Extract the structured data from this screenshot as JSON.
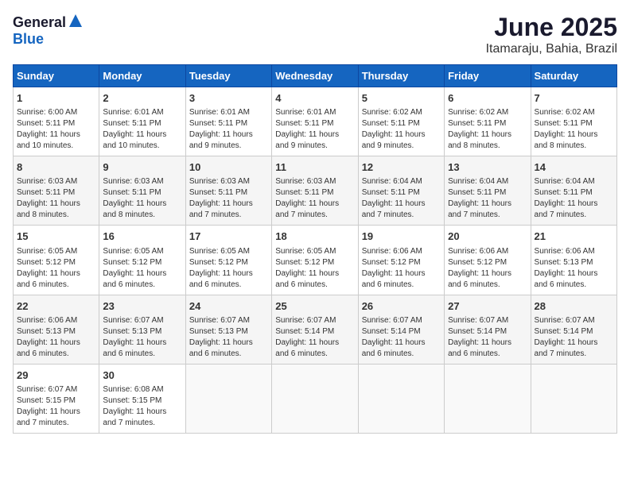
{
  "header": {
    "logo_general": "General",
    "logo_blue": "Blue",
    "month": "June 2025",
    "location": "Itamaraju, Bahia, Brazil"
  },
  "days_of_week": [
    "Sunday",
    "Monday",
    "Tuesday",
    "Wednesday",
    "Thursday",
    "Friday",
    "Saturday"
  ],
  "weeks": [
    [
      {
        "day": "1",
        "info": "Sunrise: 6:00 AM\nSunset: 5:11 PM\nDaylight: 11 hours\nand 10 minutes."
      },
      {
        "day": "2",
        "info": "Sunrise: 6:01 AM\nSunset: 5:11 PM\nDaylight: 11 hours\nand 10 minutes."
      },
      {
        "day": "3",
        "info": "Sunrise: 6:01 AM\nSunset: 5:11 PM\nDaylight: 11 hours\nand 9 minutes."
      },
      {
        "day": "4",
        "info": "Sunrise: 6:01 AM\nSunset: 5:11 PM\nDaylight: 11 hours\nand 9 minutes."
      },
      {
        "day": "5",
        "info": "Sunrise: 6:02 AM\nSunset: 5:11 PM\nDaylight: 11 hours\nand 9 minutes."
      },
      {
        "day": "6",
        "info": "Sunrise: 6:02 AM\nSunset: 5:11 PM\nDaylight: 11 hours\nand 8 minutes."
      },
      {
        "day": "7",
        "info": "Sunrise: 6:02 AM\nSunset: 5:11 PM\nDaylight: 11 hours\nand 8 minutes."
      }
    ],
    [
      {
        "day": "8",
        "info": "Sunrise: 6:03 AM\nSunset: 5:11 PM\nDaylight: 11 hours\nand 8 minutes."
      },
      {
        "day": "9",
        "info": "Sunrise: 6:03 AM\nSunset: 5:11 PM\nDaylight: 11 hours\nand 8 minutes."
      },
      {
        "day": "10",
        "info": "Sunrise: 6:03 AM\nSunset: 5:11 PM\nDaylight: 11 hours\nand 7 minutes."
      },
      {
        "day": "11",
        "info": "Sunrise: 6:03 AM\nSunset: 5:11 PM\nDaylight: 11 hours\nand 7 minutes."
      },
      {
        "day": "12",
        "info": "Sunrise: 6:04 AM\nSunset: 5:11 PM\nDaylight: 11 hours\nand 7 minutes."
      },
      {
        "day": "13",
        "info": "Sunrise: 6:04 AM\nSunset: 5:11 PM\nDaylight: 11 hours\nand 7 minutes."
      },
      {
        "day": "14",
        "info": "Sunrise: 6:04 AM\nSunset: 5:11 PM\nDaylight: 11 hours\nand 7 minutes."
      }
    ],
    [
      {
        "day": "15",
        "info": "Sunrise: 6:05 AM\nSunset: 5:12 PM\nDaylight: 11 hours\nand 6 minutes."
      },
      {
        "day": "16",
        "info": "Sunrise: 6:05 AM\nSunset: 5:12 PM\nDaylight: 11 hours\nand 6 minutes."
      },
      {
        "day": "17",
        "info": "Sunrise: 6:05 AM\nSunset: 5:12 PM\nDaylight: 11 hours\nand 6 minutes."
      },
      {
        "day": "18",
        "info": "Sunrise: 6:05 AM\nSunset: 5:12 PM\nDaylight: 11 hours\nand 6 minutes."
      },
      {
        "day": "19",
        "info": "Sunrise: 6:06 AM\nSunset: 5:12 PM\nDaylight: 11 hours\nand 6 minutes."
      },
      {
        "day": "20",
        "info": "Sunrise: 6:06 AM\nSunset: 5:12 PM\nDaylight: 11 hours\nand 6 minutes."
      },
      {
        "day": "21",
        "info": "Sunrise: 6:06 AM\nSunset: 5:13 PM\nDaylight: 11 hours\nand 6 minutes."
      }
    ],
    [
      {
        "day": "22",
        "info": "Sunrise: 6:06 AM\nSunset: 5:13 PM\nDaylight: 11 hours\nand 6 minutes."
      },
      {
        "day": "23",
        "info": "Sunrise: 6:07 AM\nSunset: 5:13 PM\nDaylight: 11 hours\nand 6 minutes."
      },
      {
        "day": "24",
        "info": "Sunrise: 6:07 AM\nSunset: 5:13 PM\nDaylight: 11 hours\nand 6 minutes."
      },
      {
        "day": "25",
        "info": "Sunrise: 6:07 AM\nSunset: 5:14 PM\nDaylight: 11 hours\nand 6 minutes."
      },
      {
        "day": "26",
        "info": "Sunrise: 6:07 AM\nSunset: 5:14 PM\nDaylight: 11 hours\nand 6 minutes."
      },
      {
        "day": "27",
        "info": "Sunrise: 6:07 AM\nSunset: 5:14 PM\nDaylight: 11 hours\nand 6 minutes."
      },
      {
        "day": "28",
        "info": "Sunrise: 6:07 AM\nSunset: 5:14 PM\nDaylight: 11 hours\nand 7 minutes."
      }
    ],
    [
      {
        "day": "29",
        "info": "Sunrise: 6:07 AM\nSunset: 5:15 PM\nDaylight: 11 hours\nand 7 minutes."
      },
      {
        "day": "30",
        "info": "Sunrise: 6:08 AM\nSunset: 5:15 PM\nDaylight: 11 hours\nand 7 minutes."
      },
      {
        "day": "",
        "info": ""
      },
      {
        "day": "",
        "info": ""
      },
      {
        "day": "",
        "info": ""
      },
      {
        "day": "",
        "info": ""
      },
      {
        "day": "",
        "info": ""
      }
    ]
  ]
}
